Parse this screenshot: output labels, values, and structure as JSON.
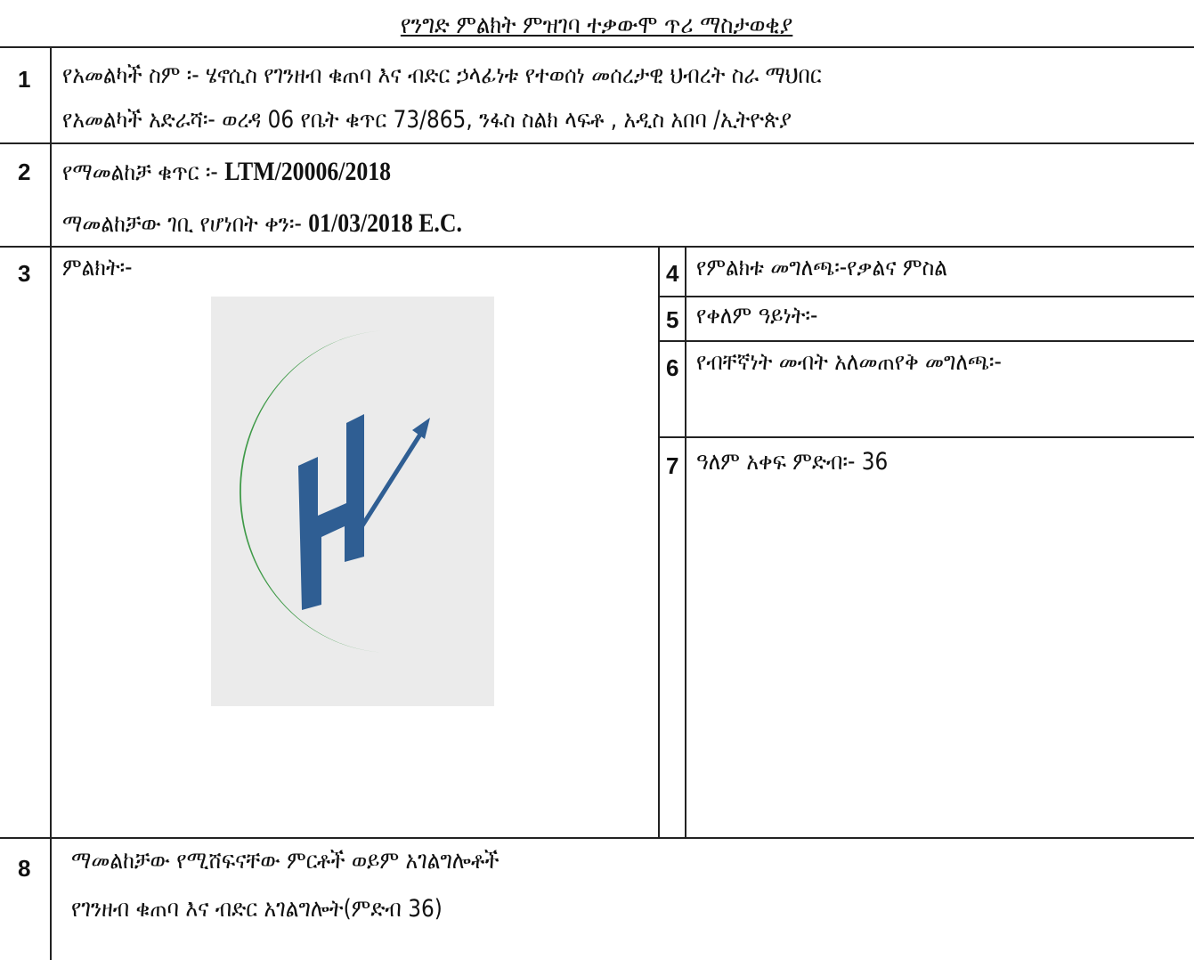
{
  "document": {
    "title": "የንግድ ምልክት ምዝገባ ተቃውሞ ጥሪ ማስታወቂያ",
    "rows": [
      {
        "number": "1",
        "owner_name_label": "የአመልካች ስም ፡-",
        "owner_name_value": "ሄኖሲስ የገንዘብ ቁጠባ እና ብድር ኃላፊነቱ የተወሰነ መሰረታዊ ህብረት ስራ ማህበር",
        "owner_address_label": "የአመልካች አድራሻ፡-",
        "owner_address_value": "ወረዳ 06 የቤት ቁጥር 73/865, ንፋስ ስልክ ላፍቶ , አዲስ አበባ /ኢትዮጵያ"
      },
      {
        "number": "2",
        "application_no_label": "የማመልከቻ ቁጥር ፡-",
        "application_no_value": "LTM/20006/2018",
        "filing_date_label": "ማመልከቻው ገቢ የሆነበት ቀን፡-",
        "filing_date_value": "01/03/2018 E.C."
      },
      {
        "number": "3",
        "mark_label": "ምልክት፡-",
        "mark_image": "trademark-logo-green-arc-blue-h-arrow"
      },
      {
        "number": "4",
        "label": "የምልክቱ መግለጫ፡-",
        "value": "የቃልና ምስል"
      },
      {
        "number": "5",
        "label": "የቀለም ዓይነት፡-",
        "value": ""
      },
      {
        "number": "6",
        "label": "የብቸኛነት መብት አለመጠየቅ መግለጫ፡-",
        "value": ""
      },
      {
        "number": "7",
        "label": "ዓለም አቀፍ ምድብ፡-",
        "value": "36"
      },
      {
        "number": "8",
        "label": "ማመልከቻው የሚሸፍናቸው ምርቶች ወይም አገልግሎቶች",
        "value": "የገንዘብ ቁጠባ እና ብድር አገልግሎት(ምድብ 36)"
      }
    ]
  },
  "colors": {
    "logo_green": "#3f9a48",
    "logo_blue": "#2f5e93",
    "logo_background": "#ebebeb",
    "rule_color": "#222222"
  }
}
